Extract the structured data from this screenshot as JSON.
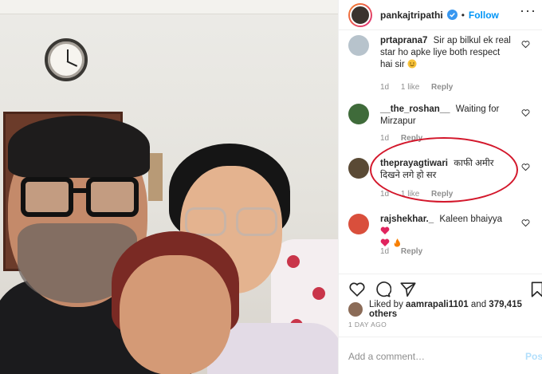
{
  "post": {
    "username": "pankajtripathi",
    "follow_label": "Follow",
    "separator": "•"
  },
  "comments": [
    {
      "username": "prtaprana7",
      "text": "Sir ap bilkul ek real star ho apke liye both respect hai sir",
      "emoji": "smile",
      "time": "1d",
      "likes": "1 like",
      "reply": "Reply"
    },
    {
      "username": "__the_roshan__",
      "text": "Waiting for Mirzapur",
      "time": "1d",
      "reply": "Reply"
    },
    {
      "username": "theprayagtiwari",
      "text": "काफी अमीर दिखने लगे हो सर",
      "time": "1d",
      "likes": "1 like",
      "reply": "Reply"
    },
    {
      "username": "rajshekhar._",
      "text": "Kaleen bhaiyya",
      "emoji": "hearts-fire",
      "time": "1d",
      "reply": "Reply"
    }
  ],
  "likes": {
    "prefix": "Liked by",
    "user": "aamrapali1101",
    "middle": "and",
    "count": "379,415 others"
  },
  "time_ago": "1 DAY AGO",
  "comment_box": {
    "placeholder": "Add a comment…",
    "post_label": "Post"
  },
  "colors": {
    "link": "#0095f6",
    "muted": "#8e8e8e",
    "highlight": "#d3172b",
    "heart": "#ed4956"
  },
  "icons": [
    "verified-icon",
    "more-icon",
    "heart-icon",
    "comment-icon",
    "share-icon",
    "bookmark-icon"
  ]
}
